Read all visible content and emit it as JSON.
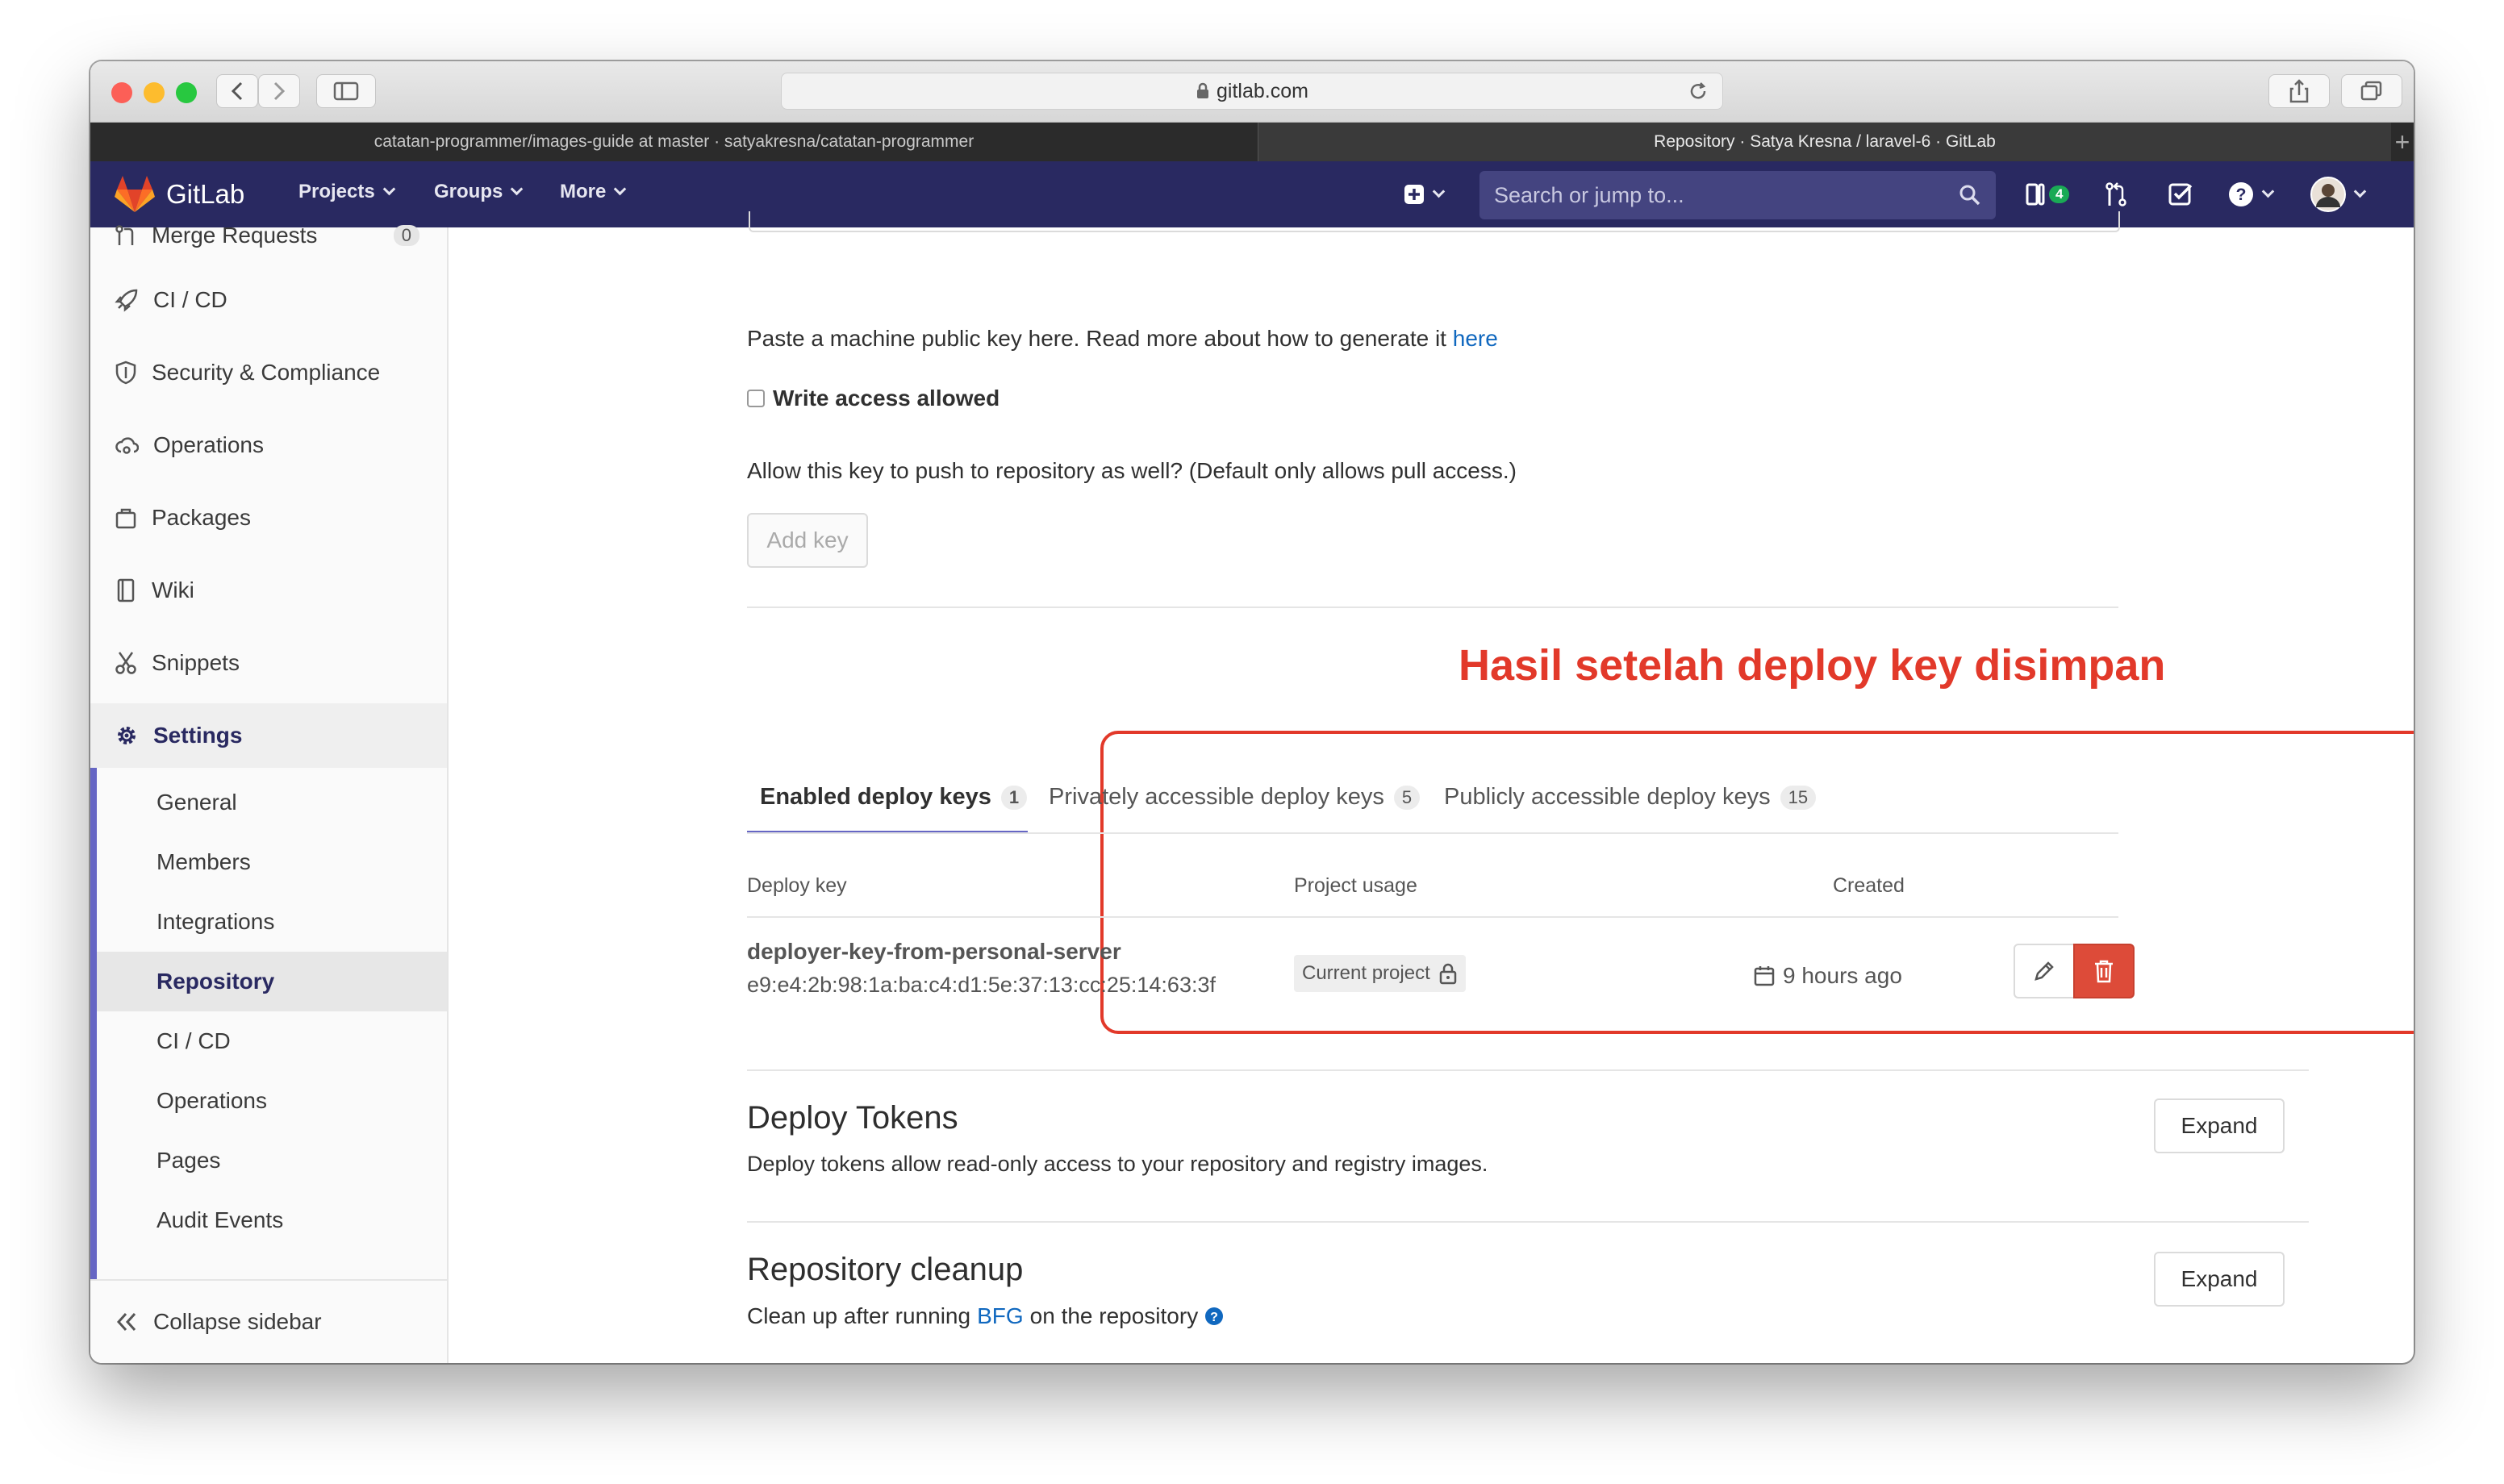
{
  "browser": {
    "url": "gitlab.com",
    "tabs": [
      {
        "label": "catatan-programmer/images-guide at master · satyakresna/catatan-programmer"
      },
      {
        "label": "Repository · Satya Kresna / laravel-6 · GitLab"
      }
    ]
  },
  "navbar": {
    "brand": "GitLab",
    "items": [
      "Projects",
      "Groups",
      "More"
    ],
    "search_placeholder": "Search or jump to...",
    "todo_count": "4"
  },
  "sidebar": {
    "items": [
      {
        "label": "Merge Requests",
        "count": "0"
      },
      {
        "label": "CI / CD"
      },
      {
        "label": "Security & Compliance"
      },
      {
        "label": "Operations"
      },
      {
        "label": "Packages"
      },
      {
        "label": "Wiki"
      },
      {
        "label": "Snippets"
      },
      {
        "label": "Settings"
      }
    ],
    "settings_sub": [
      "General",
      "Members",
      "Integrations",
      "Repository",
      "CI / CD",
      "Operations",
      "Pages",
      "Audit Events"
    ],
    "collapse_label": "Collapse sidebar"
  },
  "deploy_form": {
    "help_text": "Paste a machine public key here. Read more about how to generate it",
    "help_link": "here",
    "write_access_label": "Write access allowed",
    "write_access_help": "Allow this key to push to repository as well? (Default only allows pull access.)",
    "add_key_label": "Add key"
  },
  "annotation": "Hasil setelah deploy key disimpan",
  "deploy_keys": {
    "tabs": [
      {
        "label": "Enabled deploy keys",
        "count": "1"
      },
      {
        "label": "Privately accessible deploy keys",
        "count": "5"
      },
      {
        "label": "Publicly accessible deploy keys",
        "count": "15"
      }
    ],
    "headers": {
      "key": "Deploy key",
      "usage": "Project usage",
      "created": "Created"
    },
    "rows": [
      {
        "title": "deployer-key-from-personal-server",
        "fingerprint": "e9:e4:2b:98:1a:ba:c4:d1:5e:37:13:cc:25:14:63:3f",
        "usage": "Current project",
        "created": "9 hours ago"
      }
    ]
  },
  "sections": {
    "deploy_tokens": {
      "title": "Deploy Tokens",
      "desc": "Deploy tokens allow read-only access to your repository and registry images.",
      "button": "Expand"
    },
    "cleanup": {
      "title": "Repository cleanup",
      "desc_before": "Clean up after running",
      "desc_link": "BFG",
      "desc_after": "on the repository",
      "button": "Expand"
    }
  },
  "colors": {
    "navbar": "#292961",
    "accent": "#6666c4",
    "danger": "#dd4b39",
    "link": "#1068bf",
    "annotation": "#e2392a"
  }
}
